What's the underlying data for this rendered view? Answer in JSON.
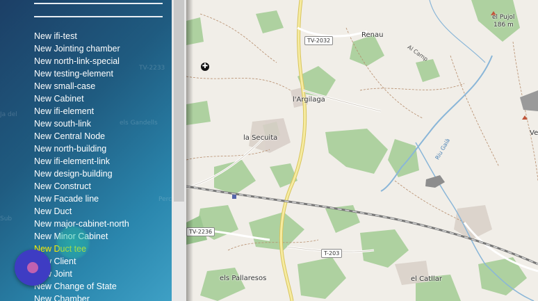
{
  "sidebar": {
    "ghost_labels": [
      "TV-2233",
      "els Gandells",
      "Perc",
      "Ja del",
      "Sub"
    ],
    "items": [
      {
        "label": "New ifi-test"
      },
      {
        "label": "New Jointing chamber"
      },
      {
        "label": "New north-link-special"
      },
      {
        "label": "New testing-element"
      },
      {
        "label": "New small-case"
      },
      {
        "label": "New Cabinet"
      },
      {
        "label": "New ifi-element"
      },
      {
        "label": "New south-link"
      },
      {
        "label": "New Central Node"
      },
      {
        "label": "New north-building"
      },
      {
        "label": "New ifi-element-link"
      },
      {
        "label": "New design-building"
      },
      {
        "label": "New Construct"
      },
      {
        "label": "New Facade line"
      },
      {
        "label": "New Duct"
      },
      {
        "label": "New major-cabinet-north"
      },
      {
        "label": "New Minor Cabinet"
      },
      {
        "label": "New Duct tee",
        "highlighted": true
      },
      {
        "label": "New Client"
      },
      {
        "label": "New Joint"
      },
      {
        "label": "New Change of State"
      },
      {
        "label": "New Chamber"
      }
    ]
  },
  "fab": {
    "icon": "circle-dot-icon",
    "color": "#3e3cc3",
    "dot_color": "#c061b0"
  },
  "colors": {
    "highlight": "#ffee00",
    "menu_text": "#ffffff"
  },
  "map": {
    "places": {
      "renau": "Renau",
      "argilaga": "l'Argilaga",
      "secuita": "la Secuita",
      "pallaresos": "els Pallaresos",
      "catllar": "el Catllar",
      "pujol": "el Pujol",
      "pujol_elev": "186 m",
      "ve": "Ve"
    },
    "roads": {
      "tv2032": "TV-2032",
      "t203": "T-203",
      "tv2236": "TV-2236",
      "al_camp": "Al Camp",
      "riu_gaia": "Riu Gaià"
    }
  }
}
